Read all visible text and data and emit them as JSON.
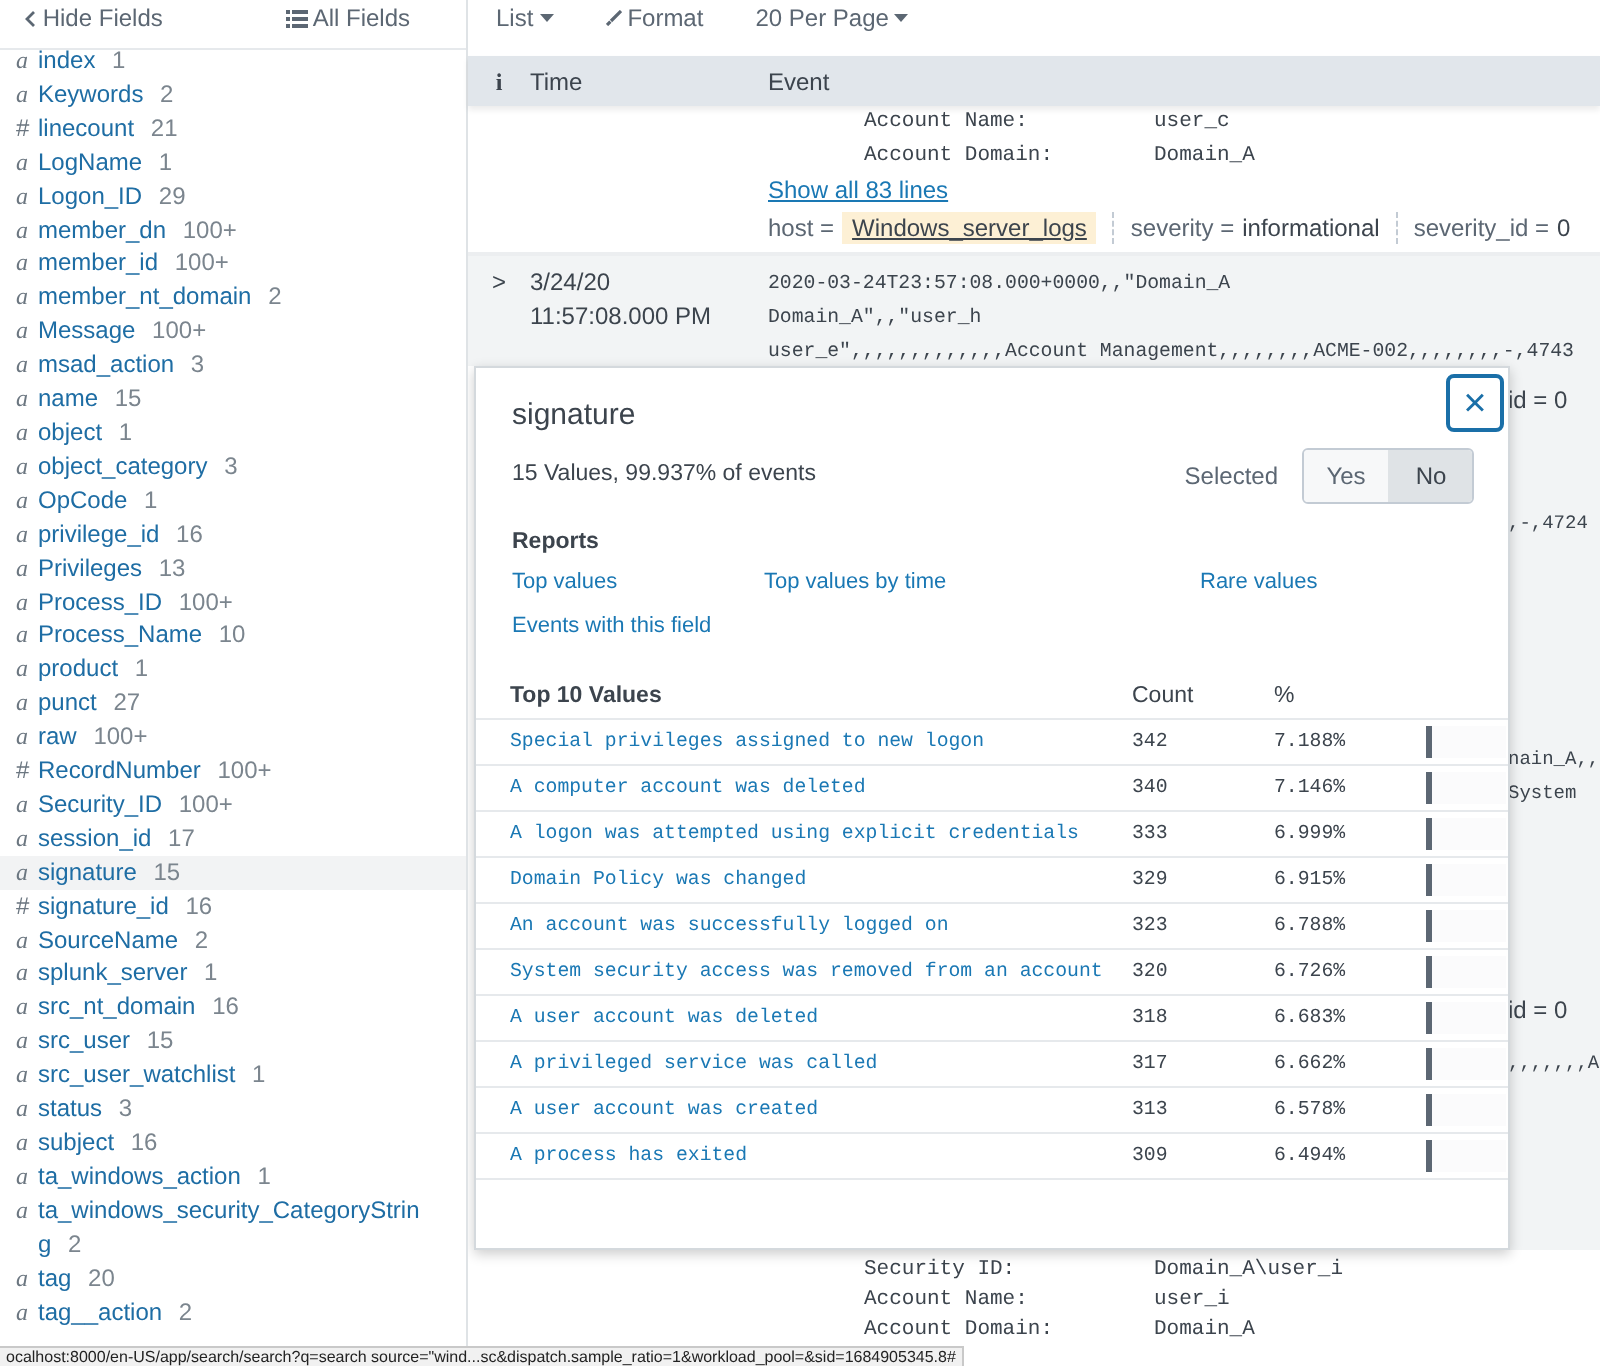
{
  "sidebar": {
    "hide_fields": "Hide Fields",
    "all_fields": "All Fields",
    "fields": [
      {
        "symbol": "a",
        "name": "index",
        "count": "1",
        "selected": false
      },
      {
        "symbol": "a",
        "name": "Keywords",
        "count": "2",
        "selected": false
      },
      {
        "symbol": "#",
        "name": "linecount",
        "count": "21",
        "selected": false
      },
      {
        "symbol": "a",
        "name": "LogName",
        "count": "1",
        "selected": false
      },
      {
        "symbol": "a",
        "name": "Logon_ID",
        "count": "29",
        "selected": false
      },
      {
        "symbol": "a",
        "name": "member_dn",
        "count": "100+",
        "selected": false
      },
      {
        "symbol": "a",
        "name": "member_id",
        "count": "100+",
        "selected": false
      },
      {
        "symbol": "a",
        "name": "member_nt_domain",
        "count": "2",
        "selected": false
      },
      {
        "symbol": "a",
        "name": "Message",
        "count": "100+",
        "selected": false
      },
      {
        "symbol": "a",
        "name": "msad_action",
        "count": "3",
        "selected": false
      },
      {
        "symbol": "a",
        "name": "name",
        "count": "15",
        "selected": false
      },
      {
        "symbol": "a",
        "name": "object",
        "count": "1",
        "selected": false
      },
      {
        "symbol": "a",
        "name": "object_category",
        "count": "3",
        "selected": false
      },
      {
        "symbol": "a",
        "name": "OpCode",
        "count": "1",
        "selected": false
      },
      {
        "symbol": "a",
        "name": "privilege_id",
        "count": "16",
        "selected": false
      },
      {
        "symbol": "a",
        "name": "Privileges",
        "count": "13",
        "selected": false
      },
      {
        "symbol": "a",
        "name": "Process_ID",
        "count": "100+",
        "selected": false
      },
      {
        "symbol": "a",
        "name": "Process_Name",
        "count": "10",
        "selected": false
      },
      {
        "symbol": "a",
        "name": "product",
        "count": "1",
        "selected": false
      },
      {
        "symbol": "a",
        "name": "punct",
        "count": "27",
        "selected": false
      },
      {
        "symbol": "a",
        "name": "raw",
        "count": "100+",
        "selected": false
      },
      {
        "symbol": "#",
        "name": "RecordNumber",
        "count": "100+",
        "selected": false
      },
      {
        "symbol": "a",
        "name": "Security_ID",
        "count": "100+",
        "selected": false
      },
      {
        "symbol": "a",
        "name": "session_id",
        "count": "17",
        "selected": false
      },
      {
        "symbol": "a",
        "name": "signature",
        "count": "15",
        "selected": true
      },
      {
        "symbol": "#",
        "name": "signature_id",
        "count": "16",
        "selected": false
      },
      {
        "symbol": "a",
        "name": "SourceName",
        "count": "2",
        "selected": false
      },
      {
        "symbol": "a",
        "name": "splunk_server",
        "count": "1",
        "selected": false
      },
      {
        "symbol": "a",
        "name": "src_nt_domain",
        "count": "16",
        "selected": false
      },
      {
        "symbol": "a",
        "name": "src_user",
        "count": "15",
        "selected": false
      },
      {
        "symbol": "a",
        "name": "src_user_watchlist",
        "count": "1",
        "selected": false
      },
      {
        "symbol": "a",
        "name": "status",
        "count": "3",
        "selected": false
      },
      {
        "symbol": "a",
        "name": "subject",
        "count": "16",
        "selected": false
      },
      {
        "symbol": "a",
        "name": "ta_windows_action",
        "count": "1",
        "selected": false
      },
      {
        "symbol": "a",
        "name": "ta_windows_security_CategoryString",
        "count": "2",
        "selected": false
      },
      {
        "symbol": "a",
        "name": "tag",
        "count": "20",
        "selected": false
      },
      {
        "symbol": "a",
        "name": "tag__action",
        "count": "2",
        "selected": false
      }
    ]
  },
  "toolbar": [
    {
      "kind": "dropdown",
      "label": "List"
    },
    {
      "kind": "brush",
      "label": "Format"
    },
    {
      "kind": "dropdown",
      "label": "20 Per Page"
    }
  ],
  "table": {
    "columns": [
      "i",
      "Time",
      "Event"
    ],
    "event_1": {
      "lines": [
        {
          "label": "Account Name:",
          "value": "user_c"
        },
        {
          "label": "Account Domain:",
          "value": "Domain_A"
        }
      ],
      "show_all": "Show all 83 lines",
      "fields": [
        {
          "key": "host =",
          "value": "Windows_server_logs",
          "highlighted": true
        },
        {
          "key": "severity =",
          "value": "informational",
          "highlighted": false
        },
        {
          "key": "severity_id =",
          "value": "0",
          "highlighted": false
        }
      ]
    },
    "event_2": {
      "expand": ">",
      "time": [
        "3/24/20",
        "11:57:08.000 PM"
      ],
      "raw": [
        "2020-03-24T23:57:08.000+0000,,\"Domain_A",
        "Domain_A\",,\"user_h",
        "user_e\",,,,,,,,,,,,,Account Management,,,,,,,,ACME-002,,,,,,,,-,4743"
      ]
    },
    "hidden_fragments": [
      "id = 0",
      ",-,4724",
      "nain_A,,",
      "System",
      "id = 0",
      ",,,,,,,A"
    ],
    "event_3_lines": [
      {
        "label": "Security ID:",
        "value": "Domain_A\\user_i"
      },
      {
        "label": "Account Name:",
        "value": "user_i"
      },
      {
        "label": "Account Domain:",
        "value": "Domain_A"
      }
    ]
  },
  "popup": {
    "title": "signature",
    "close": "×",
    "summary": "15 Values, 99.937% of events",
    "selected_label": "Selected",
    "toggle": [
      {
        "label": "Yes",
        "selected": false
      },
      {
        "label": "No",
        "selected": true
      }
    ],
    "reports_heading": "Reports",
    "reports": [
      "Top values",
      "Top values by time",
      "Rare values",
      "Events with this field"
    ],
    "top_heading": "Top 10 Values",
    "count_heading": "Count",
    "pct_heading": "%",
    "values": [
      {
        "value": "Special privileges assigned to new logon",
        "count": "342",
        "pct": "7.188%",
        "level": 0.07188
      },
      {
        "value": "A computer account was deleted",
        "count": "340",
        "pct": "7.146%",
        "level": 0.07146
      },
      {
        "value": "A logon was attempted using explicit credentials",
        "count": "333",
        "pct": "6.999%",
        "level": 0.06999
      },
      {
        "value": "Domain Policy was changed",
        "count": "329",
        "pct": "6.915%",
        "level": 0.06915
      },
      {
        "value": "An account was successfully logged on",
        "count": "323",
        "pct": "6.788%",
        "level": 0.06788
      },
      {
        "value": "System security access was removed from an account",
        "count": "320",
        "pct": "6.726%",
        "level": 0.06726
      },
      {
        "value": "A user account was deleted",
        "count": "318",
        "pct": "6.683%",
        "level": 0.06683
      },
      {
        "value": "A privileged service was called",
        "count": "317",
        "pct": "6.662%",
        "level": 0.06662
      },
      {
        "value": "A user account was created",
        "count": "313",
        "pct": "6.578%",
        "level": 0.06578
      },
      {
        "value": "A process has exited",
        "count": "309",
        "pct": "6.494%",
        "level": 0.06494
      }
    ]
  },
  "status_url": "ocalhost:8000/en-US/app/search/search?q=search source=\"wind...sc&dispatch.sample_ratio=1&workload_pool=&sid=1684905345.8#"
}
